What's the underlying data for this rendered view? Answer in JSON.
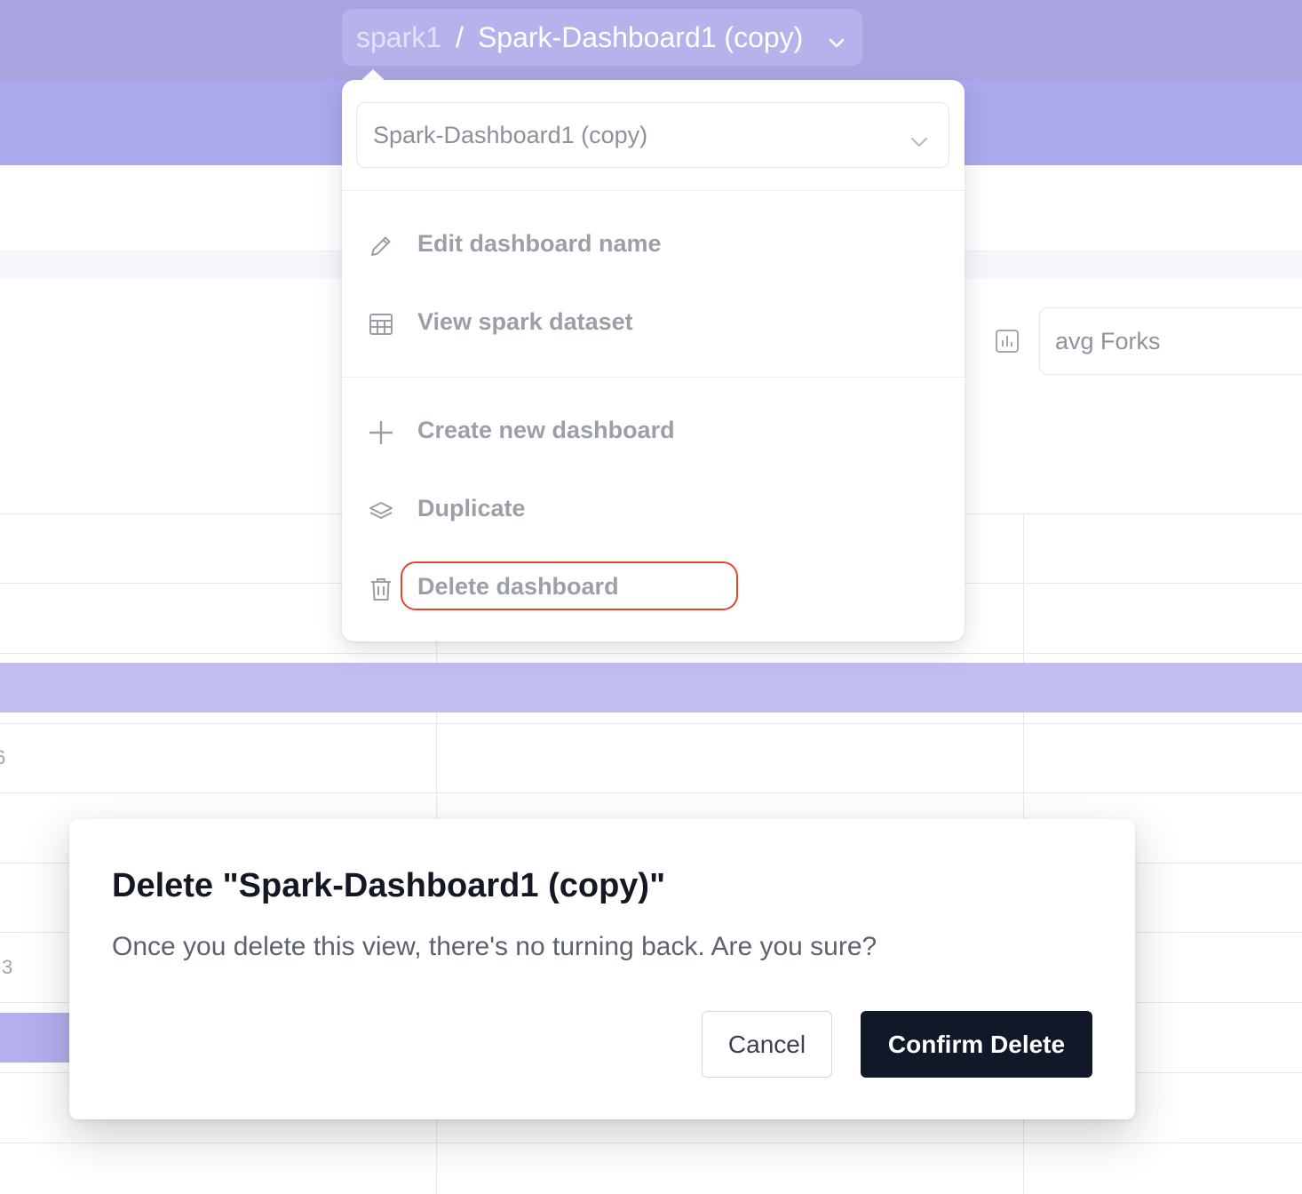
{
  "breadcrumb": {
    "workspace": "spark1",
    "separator": "/",
    "dashboard": "Spark-Dashboard1 (copy)",
    "icon": "chevron-down-icon"
  },
  "background": {
    "metric_field": "avg Forks",
    "metric_icon": "bar-chart-icon",
    "row_values": [
      "6",
      "3"
    ]
  },
  "menu": {
    "selector_value": "Spark-Dashboard1 (copy)",
    "items": [
      {
        "label": "Edit dashboard name",
        "icon": "pencil-icon"
      },
      {
        "label": "View spark dataset",
        "icon": "table-icon"
      },
      {
        "label": "Create new dashboard",
        "icon": "plus-icon"
      },
      {
        "label": "Duplicate",
        "icon": "layers-icon"
      },
      {
        "label": "Delete dashboard",
        "icon": "trash-icon",
        "highlighted": true
      }
    ]
  },
  "modal": {
    "title": "Delete \"Spark-Dashboard1 (copy)\"",
    "body": "Once you delete this view, there's no turning back. Are you sure?",
    "cancel_label": "Cancel",
    "confirm_label": "Confirm Delete"
  },
  "colors": {
    "header": "#a8a5e0",
    "accent_band": "#c0bdf0",
    "highlight_ring": "#e2462e",
    "confirm_button": "#111827"
  }
}
